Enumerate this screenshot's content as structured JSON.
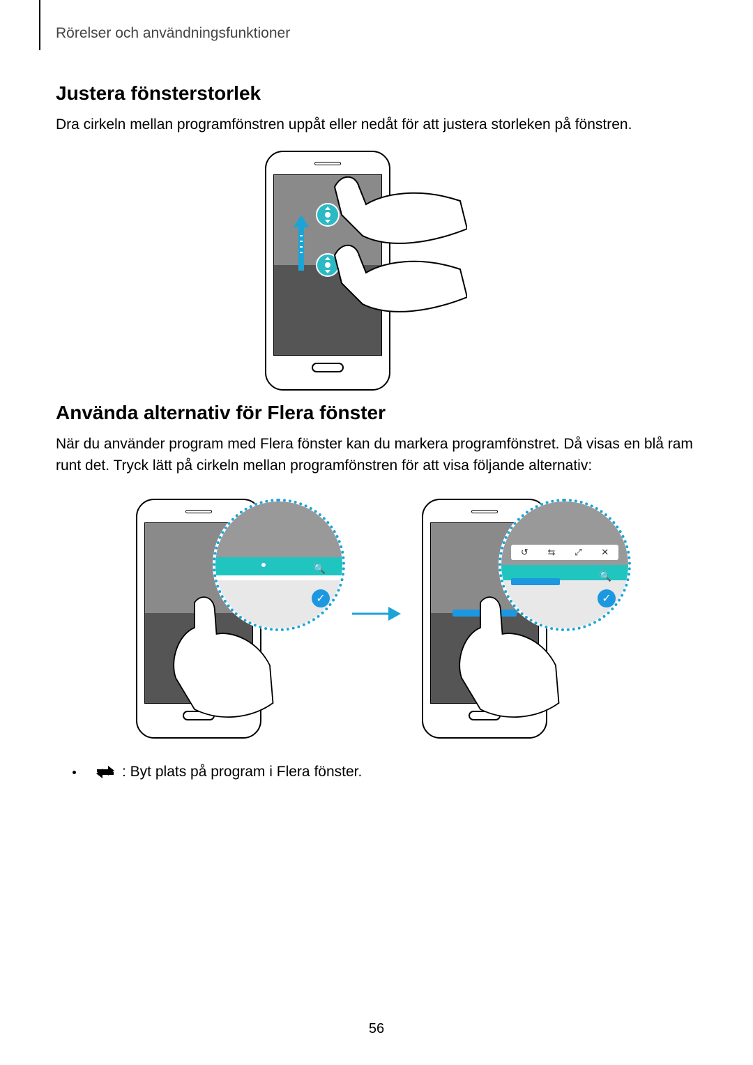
{
  "chapter": "Rörelser och användningsfunktioner",
  "section1": {
    "heading": "Justera fönsterstorlek",
    "body": "Dra cirkeln mellan programfönstren uppåt eller nedåt för att justera storleken på fönstren."
  },
  "section2": {
    "heading": "Använda alternativ för Flera fönster",
    "body": "När du använder program med Flera fönster kan du markera programfönstret. Då visas en blå ram runt det. Tryck lätt på cirkeln mellan programfönstren för att visa följande alternativ:"
  },
  "bullet1": {
    "text": " : Byt plats på program i Flera fönster."
  },
  "page_number": "56",
  "icons": {
    "swap": "swap-places-icon",
    "arrow_between": "→",
    "toolbar_items": [
      "↺",
      "⇆",
      "⤢",
      "✕"
    ]
  }
}
